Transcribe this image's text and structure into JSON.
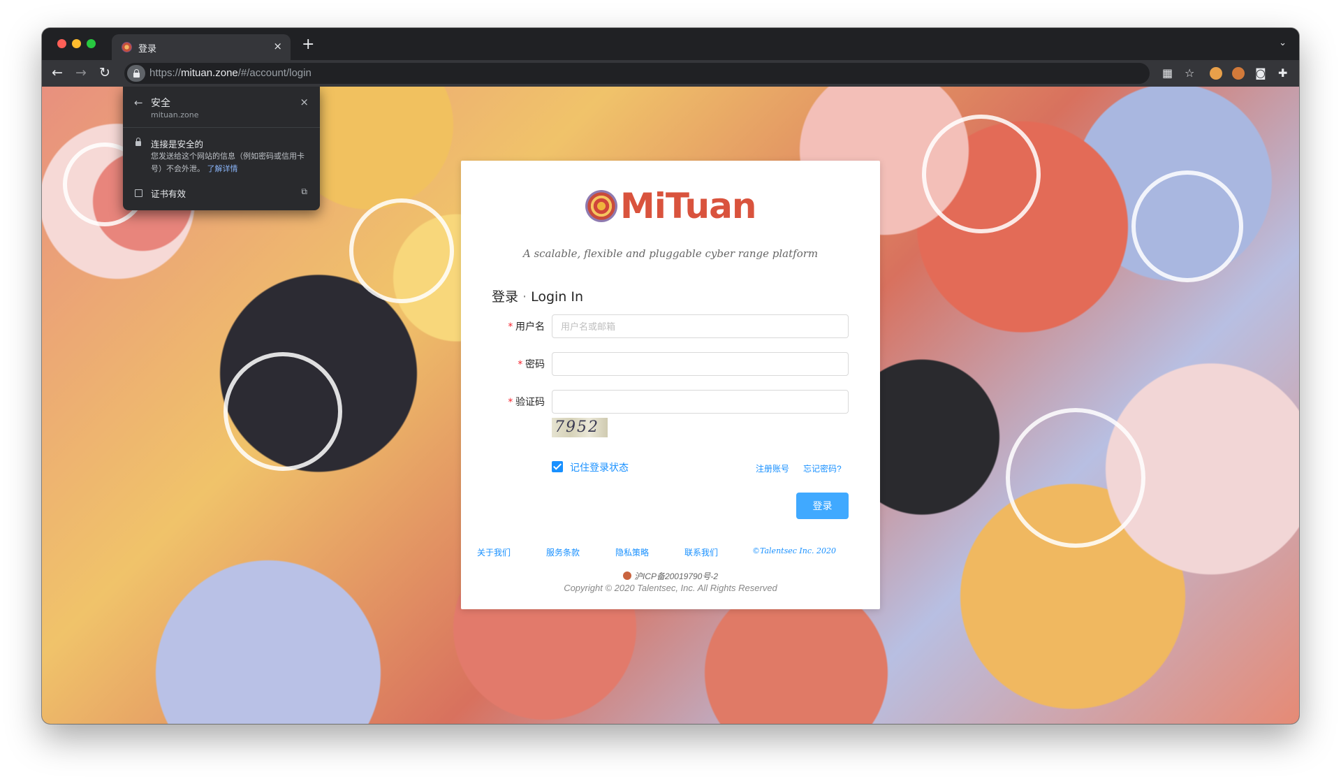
{
  "browser": {
    "tab_title": "登录",
    "tab_close": "×",
    "new_tab": "+",
    "tab_menu": "⌄",
    "back": "←",
    "forward": "→",
    "reload": "↻",
    "url_scheme": "https://",
    "url_host": "mituan.zone",
    "url_path": "/#/account/login"
  },
  "security_popup": {
    "title": "安全",
    "domain": "mituan.zone",
    "connection_secure": "连接是安全的",
    "description": "您发送给这个网站的信息（例如密码或信用卡号）不会外泄。",
    "learn_more": "了解详情",
    "certificate": "证书有效",
    "back_icon": "←",
    "close_icon": "×",
    "external_icon": "⧉"
  },
  "login": {
    "logo_text": "MiTuan",
    "tagline": "A scalable, flexible and pluggable cyber range platform",
    "heading_cn": "登录",
    "heading_sep": "·",
    "heading_en": "Login In",
    "required_mark": "*",
    "username_label": "用户名",
    "username_placeholder": "用户名或邮箱",
    "password_label": "密码",
    "captcha_label": "验证码",
    "captcha_value": "7952",
    "remember_label": "记住登录状态",
    "register_link": "注册账号",
    "forgot_link": "忘记密码?",
    "submit_label": "登录"
  },
  "footer": {
    "links": [
      "关于我们",
      "服务条款",
      "隐私策略",
      "联系我们"
    ],
    "copy_small": "©Talentsec Inc. 2020",
    "icp": "沪ICP备20019790号-2",
    "copyright": "Copyright © 2020 Talentsec, Inc. All Rights Reserved"
  },
  "colors": {
    "brand": "#d9533d",
    "primary": "#1890ff",
    "button": "#40a9ff"
  }
}
